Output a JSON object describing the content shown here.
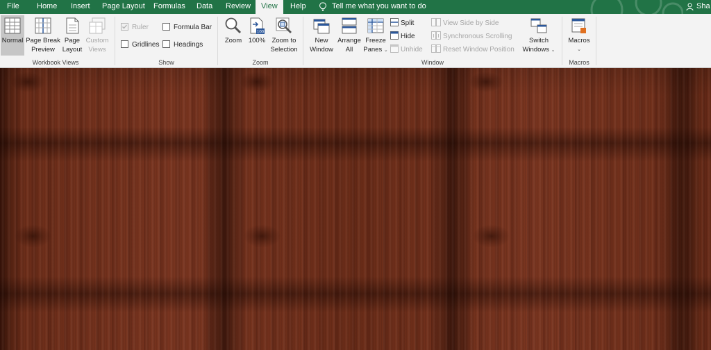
{
  "tabs": [
    {
      "label": "File",
      "active": false
    },
    {
      "label": "Home",
      "active": false
    },
    {
      "label": "Insert",
      "active": false
    },
    {
      "label": "Page Layout",
      "active": false
    },
    {
      "label": "Formulas",
      "active": false
    },
    {
      "label": "Data",
      "active": false
    },
    {
      "label": "Review",
      "active": false
    },
    {
      "label": "View",
      "active": true
    },
    {
      "label": "Help",
      "active": false
    }
  ],
  "tell_me": "Tell me what you want to do",
  "share": "Sha",
  "colors": {
    "accent": "#217346",
    "ribbon_bg": "#f3f3f3"
  },
  "groups": {
    "workbook_views": {
      "label": "Workbook Views",
      "normal": "Normal",
      "page_break_1": "Page Break",
      "page_break_2": "Preview",
      "page_layout_1": "Page",
      "page_layout_2": "Layout",
      "custom_views_1": "Custom",
      "custom_views_2": "Views"
    },
    "show": {
      "label": "Show",
      "ruler": "Ruler",
      "formula_bar": "Formula Bar",
      "gridlines": "Gridlines",
      "headings": "Headings"
    },
    "zoom": {
      "label": "Zoom",
      "zoom": "Zoom",
      "zoom_100": "100%",
      "zoom_sel_1": "Zoom to",
      "zoom_sel_2": "Selection"
    },
    "window": {
      "label": "Window",
      "new_window_1": "New",
      "new_window_2": "Window",
      "arrange_1": "Arrange",
      "arrange_2": "All",
      "freeze_1": "Freeze",
      "freeze_2": "Panes",
      "split": "Split",
      "hide": "Hide",
      "unhide": "Unhide",
      "side_by_side": "View Side by Side",
      "sync_scroll": "Synchronous Scrolling",
      "reset_pos": "Reset Window Position",
      "switch_1": "Switch",
      "switch_2": "Windows"
    },
    "macros": {
      "label": "Macros",
      "macros": "Macros"
    }
  },
  "icons": [
    "lightbulb-icon",
    "person-icon",
    "normal-view-icon",
    "page-break-icon",
    "page-layout-icon",
    "custom-views-icon",
    "zoom-icon",
    "zoom-100-icon",
    "zoom-selection-icon",
    "new-window-icon",
    "arrange-all-icon",
    "freeze-panes-icon",
    "split-icon",
    "hide-icon",
    "unhide-icon",
    "side-by-side-icon",
    "sync-scroll-icon",
    "reset-position-icon",
    "switch-windows-icon",
    "macros-icon"
  ]
}
